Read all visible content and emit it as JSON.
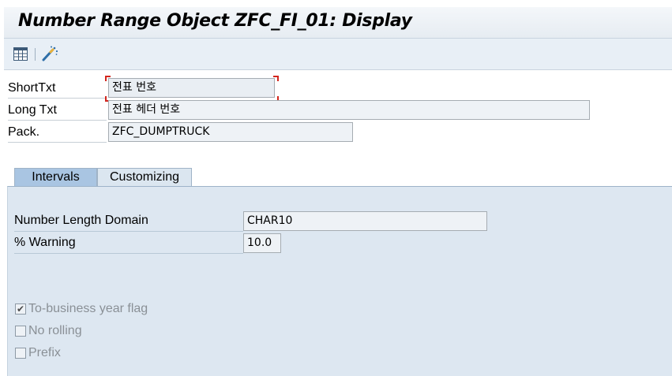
{
  "title": "Number Range Object ZFC_FI_01: Display",
  "toolbar": {
    "icons": [
      "table-icon",
      "magic-wand-icon"
    ]
  },
  "form": {
    "short_txt": {
      "label": "ShortTxt",
      "value": "전표 번호"
    },
    "long_txt": {
      "label": "Long Txt",
      "value": "전표 헤더 번호"
    },
    "pack": {
      "label": "Pack.",
      "value": "ZFC_DUMPTRUCK"
    }
  },
  "tabs": [
    {
      "label": "Intervals",
      "active": true
    },
    {
      "label": "Customizing",
      "active": false
    }
  ],
  "intervals": {
    "number_length_domain": {
      "label": "Number Length Domain",
      "value": "CHAR10"
    },
    "warning": {
      "label": "% Warning",
      "value": "10.0"
    },
    "checkboxes": [
      {
        "label": "To-business year flag",
        "checked": true
      },
      {
        "label": "No rolling",
        "checked": false
      },
      {
        "label": "Prefix",
        "checked": false
      }
    ]
  },
  "colors": {
    "accent_tab": "#a9c5e2",
    "panel": "#dde7f1",
    "focus_marker": "#d2251d"
  }
}
